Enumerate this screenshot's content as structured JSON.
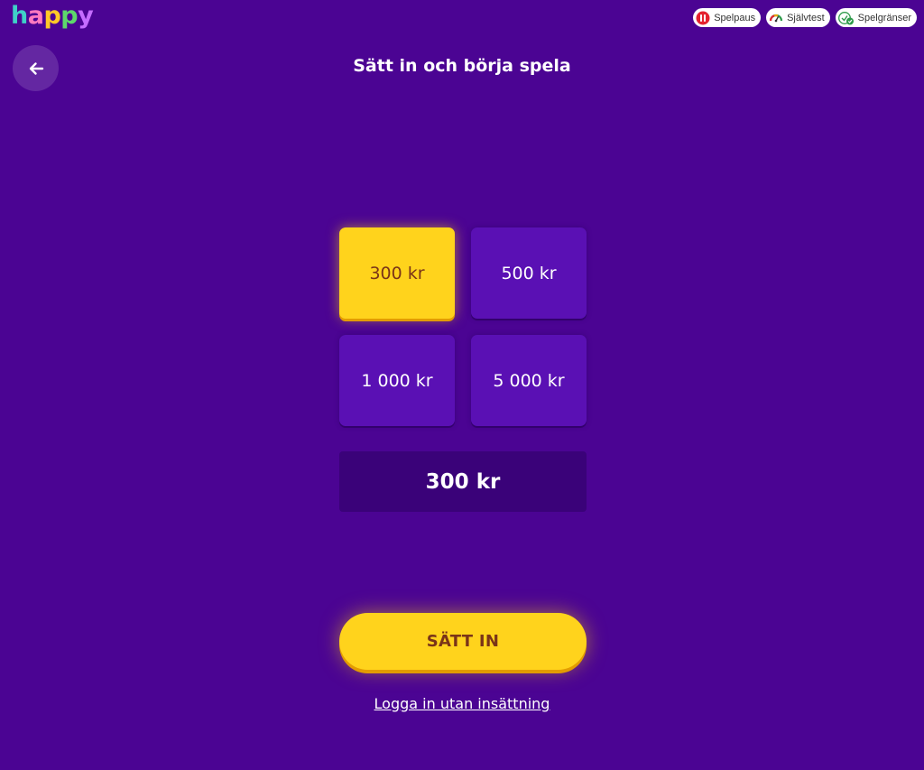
{
  "brand": {
    "logo_letters": [
      "h",
      "a",
      "p",
      "p",
      "y"
    ],
    "logo_colors": [
      "#3fd0c8",
      "#ff7ac0",
      "#ffc928",
      "#5dd86b",
      "#c56cff"
    ]
  },
  "responsible_gaming": {
    "items": [
      {
        "label": "Spelpaus",
        "icon": "pause-icon",
        "color": "#e4232f"
      },
      {
        "label": "Självtest",
        "icon": "gauge-icon",
        "color": "#f2a600"
      },
      {
        "label": "Spelgränser",
        "icon": "limits-icon",
        "color": "#2e9b4a"
      }
    ]
  },
  "header": {
    "back_icon": "arrow-left-icon",
    "title": "Sätt in och börja spela"
  },
  "deposit": {
    "options": [
      {
        "label": "300 kr",
        "selected": true
      },
      {
        "label": "500 kr",
        "selected": false
      },
      {
        "label": "1 000 kr",
        "selected": false
      },
      {
        "label": "5 000 kr",
        "selected": false
      }
    ],
    "amount_value": "300 kr",
    "submit_label": "SÄTT IN",
    "login_link": "Logga in utan insättning"
  },
  "colors": {
    "background": "#4b0493",
    "accent_yellow": "#ffd31c",
    "button_purple": "#5a10b4",
    "input_dark": "#3a0279"
  }
}
